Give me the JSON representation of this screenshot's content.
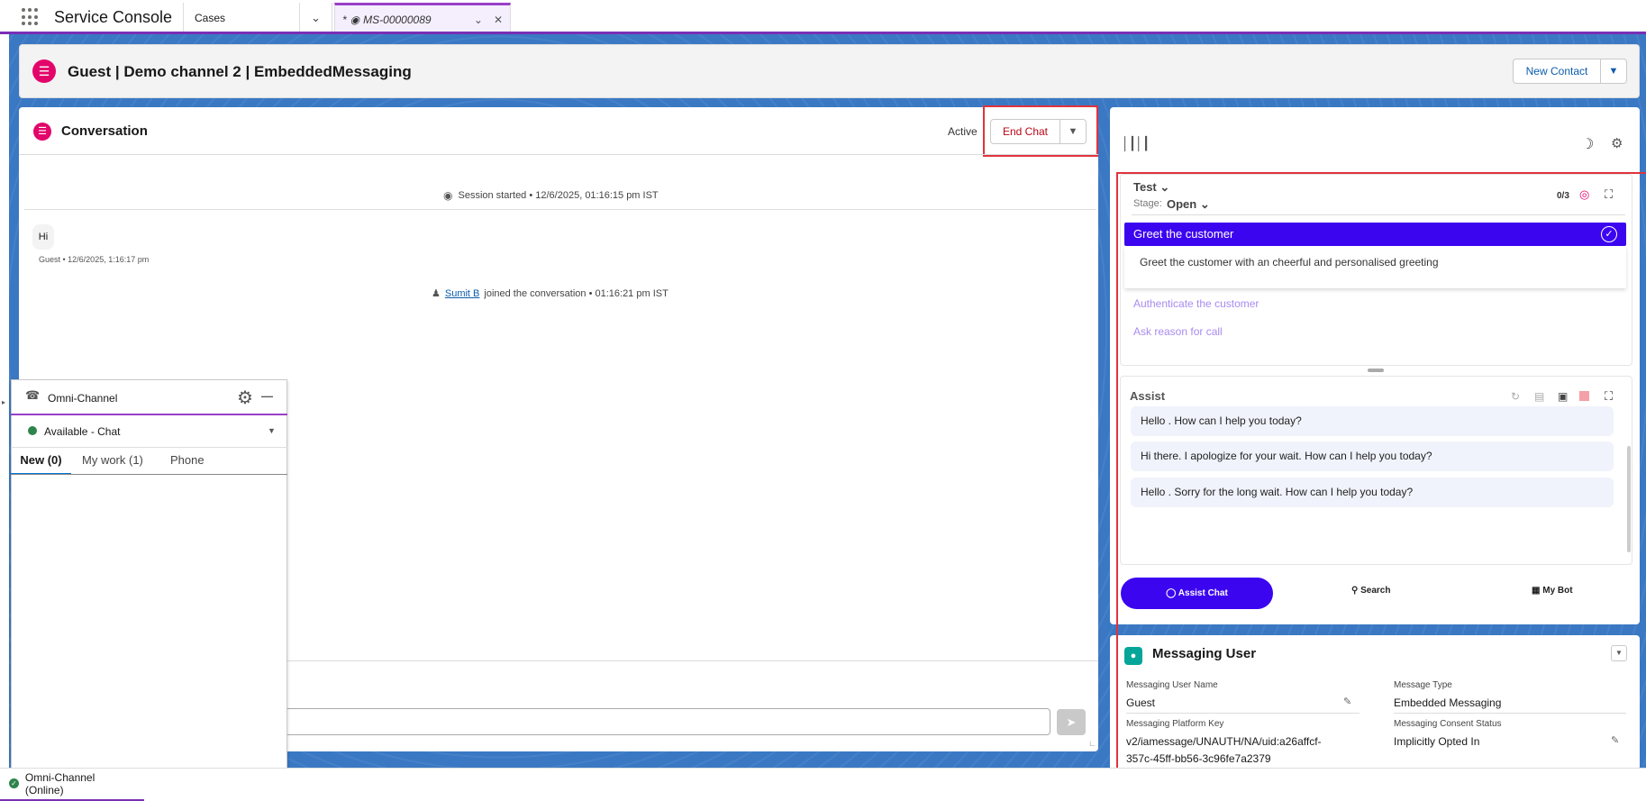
{
  "nav": {
    "app_name": "Service Console",
    "object_tab": "Cases",
    "workspace_tab": "MS-00000089",
    "workspace_tab_prefix": "*"
  },
  "record": {
    "title": "Guest | Demo channel 2 | EmbeddedMessaging",
    "new_contact_label": "New Contact"
  },
  "conversation": {
    "title": "Conversation",
    "status": "Active",
    "end_chat_label": "End Chat",
    "session_started": "Session started • 12/6/2025, 01:16:15 pm IST",
    "messages": [
      {
        "text": "Hi",
        "meta": "Guest • 12/6/2025, 1:16:17 pm"
      }
    ],
    "joined": {
      "name": "Sumit B",
      "text": "joined the conversation • 01:16:21 pm IST"
    }
  },
  "omni": {
    "title": "Omni-Channel",
    "status": "Available - Chat",
    "tabs": [
      "New (0)",
      "My work (1)",
      "Phone"
    ]
  },
  "test_panel": {
    "title": "Test",
    "stage_label": "Stage:",
    "stage_value": "Open",
    "progress": "0/3",
    "steps": [
      {
        "title": "Greet the customer",
        "description": "Greet the customer with an cheerful and personalised greeting",
        "active": true
      },
      {
        "title": "Authenticate the customer",
        "active": false
      },
      {
        "title": "Ask reason for call",
        "active": false
      }
    ]
  },
  "assist": {
    "title": "Assist",
    "suggestions": [
      "Hello . How can I help you today?",
      "Hi there. I apologize for your wait. How can I help you today?",
      "Hello . Sorry for the long wait. How can I help you today?"
    ],
    "buttons": {
      "assist_chat": "Assist Chat",
      "search": "Search",
      "my_bot": "My Bot"
    }
  },
  "messaging_user": {
    "title": "Messaging User",
    "fields": {
      "user_name_label": "Messaging User Name",
      "user_name_value": "Guest",
      "message_type_label": "Message Type",
      "message_type_value": "Embedded Messaging",
      "platform_key_label": "Messaging Platform Key",
      "platform_key_value_line1": "v2/iamessage/UNAUTH/NA/uid:a26affcf-",
      "platform_key_value_line2": "357c-45ff-bb56-3c96fe7a2379",
      "consent_label": "Messaging Consent Status",
      "consent_value": "Implicitly Opted In"
    }
  },
  "footer": {
    "omni_status": "Omni-Channel (Online)"
  },
  "colors": {
    "accent_purple": "#3c05f0",
    "brand_pink": "#e3066a",
    "highlight_red": "#e0333d",
    "online_green": "#2e844a"
  },
  "icons": [
    "app-launcher-icon",
    "messaging-icon",
    "settings-icon",
    "moon-icon",
    "waveform-icon",
    "target-icon",
    "expand-icon",
    "send-icon",
    "search-icon",
    "bot-icon"
  ]
}
